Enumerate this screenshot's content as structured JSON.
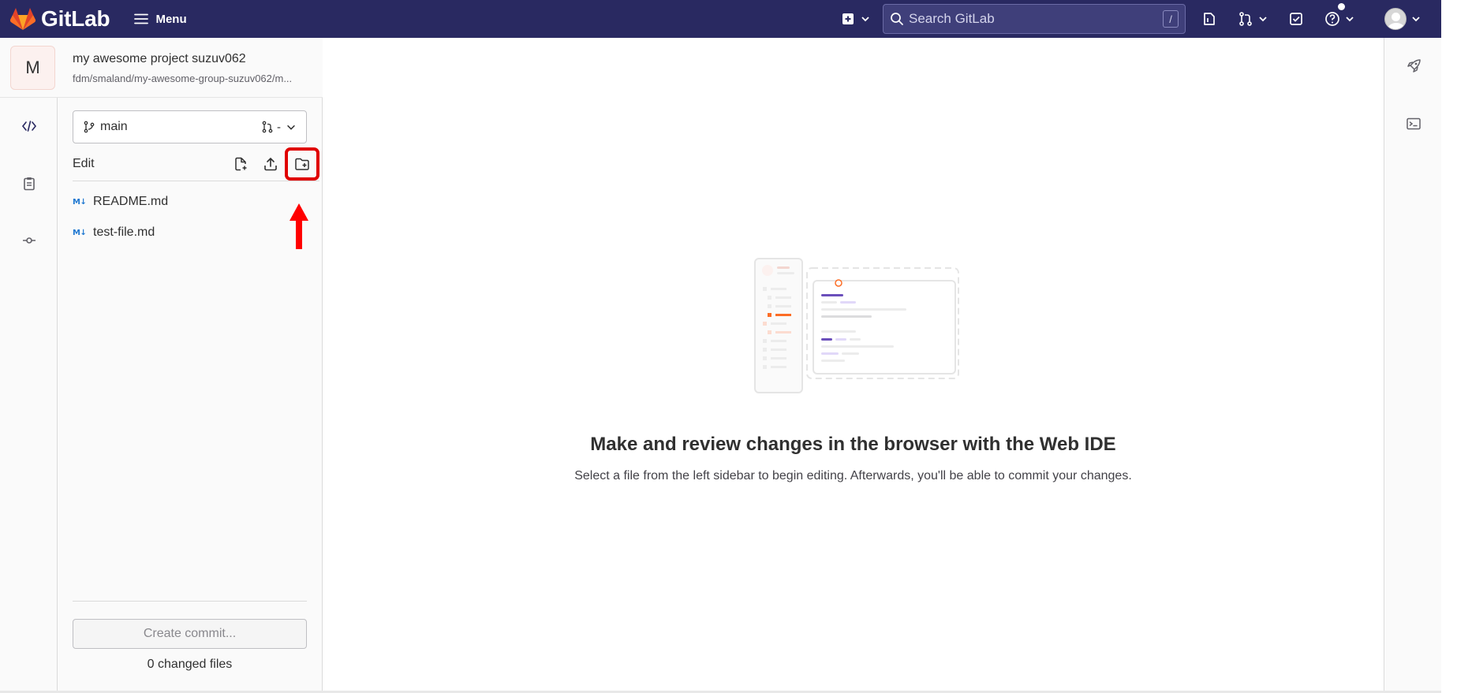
{
  "navbar": {
    "brand": "GitLab",
    "menu_label": "Menu",
    "search_placeholder": "Search GitLab",
    "search_shortcut": "/",
    "icons": [
      "plus-square-icon",
      "issues-icon",
      "merge-request-icon",
      "todo-icon",
      "help-icon",
      "avatar"
    ]
  },
  "project": {
    "avatar_letter": "M",
    "name": "my awesome project suzuv062",
    "path": "fdm/smaland/my-awesome-group-suzuv062/m..."
  },
  "activity_bar": {
    "items": [
      "code-icon",
      "review-icon",
      "commit-icon"
    ]
  },
  "file_panel": {
    "branch": "main",
    "mr_placeholder": "-",
    "edit_label": "Edit",
    "actions": [
      "new-file",
      "upload-file",
      "new-directory"
    ],
    "files": [
      {
        "name": "README.md",
        "type_badge": "M↓"
      },
      {
        "name": "test-file.md",
        "type_badge": "M↓"
      }
    ],
    "commit_button": "Create commit...",
    "changed_files": "0 changed files"
  },
  "empty_state": {
    "title": "Make and review changes in the browser with the Web IDE",
    "description": "Select a file from the left sidebar to begin editing. Afterwards, you'll be able to commit your changes."
  },
  "right_bar": {
    "items": [
      "rocket-icon",
      "terminal-icon"
    ]
  },
  "colors": {
    "navbar": "#292961",
    "highlight": "#e00000",
    "accent_orange": "#fc6d26",
    "accent_purple": "#6b4fbb"
  }
}
